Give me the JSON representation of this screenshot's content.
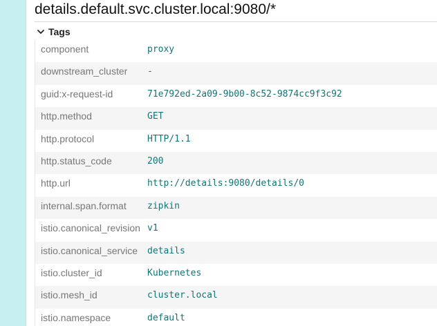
{
  "span": {
    "title": "details.default.svc.cluster.local:9080/*"
  },
  "tags_section": {
    "label": "Tags",
    "toggle_icon": "chevron-down-icon"
  },
  "tags": [
    {
      "key": "component",
      "value": "proxy"
    },
    {
      "key": "downstream_cluster",
      "value": "-"
    },
    {
      "key": "guid:x-request-id",
      "value": "71e792ed-2a09-9b00-8c52-9874cc9f3c92"
    },
    {
      "key": "http.method",
      "value": "GET"
    },
    {
      "key": "http.protocol",
      "value": "HTTP/1.1"
    },
    {
      "key": "http.status_code",
      "value": "200"
    },
    {
      "key": "http.url",
      "value": "http://details:9080/details/0"
    },
    {
      "key": "internal.span.format",
      "value": "zipkin"
    },
    {
      "key": "istio.canonical_revision",
      "value": "v1"
    },
    {
      "key": "istio.canonical_service",
      "value": "details"
    },
    {
      "key": "istio.cluster_id",
      "value": "Kubernetes"
    },
    {
      "key": "istio.mesh_id",
      "value": "cluster.local"
    },
    {
      "key": "istio.namespace",
      "value": "default"
    }
  ],
  "colors": {
    "value_text": "#127475",
    "key_text": "#777777",
    "row_stripe": "#f5f5f5",
    "left_strip": "#c7eff0"
  }
}
